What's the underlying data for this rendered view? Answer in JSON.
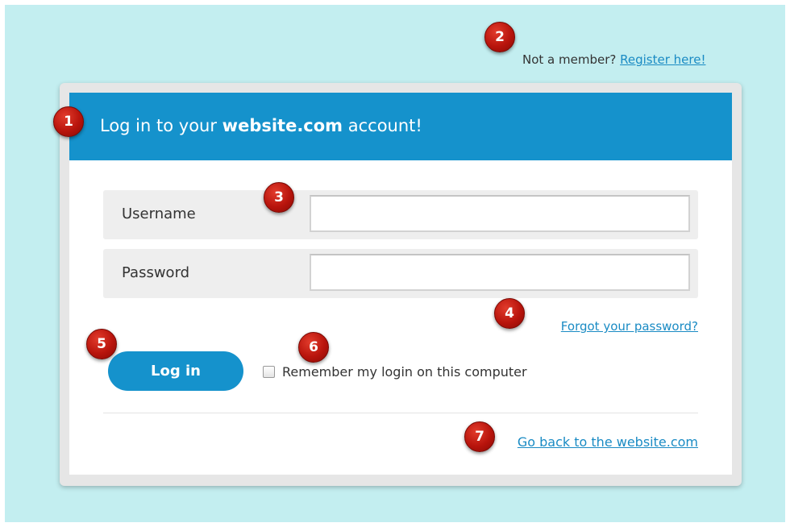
{
  "register": {
    "prompt": "Not a member?",
    "link": "Register here!"
  },
  "header": {
    "title_prefix": "Log in to your",
    "title_site": "website.com",
    "title_suffix": "account!"
  },
  "form": {
    "username_label": "Username",
    "username_value": "",
    "password_label": "Password",
    "password_value": "",
    "forgot_link": "Forgot your password?",
    "login_button": "Log in",
    "remember_label": "Remember my login on this computer",
    "remember_checked": false,
    "back_link": "Go back to the website.com"
  },
  "annotations": [
    "1",
    "2",
    "3",
    "4",
    "5",
    "6",
    "7"
  ],
  "colors": {
    "background": "#c3eef0",
    "header": "#1592cc",
    "link": "#1a8bc4",
    "badge": "#b8140c"
  }
}
